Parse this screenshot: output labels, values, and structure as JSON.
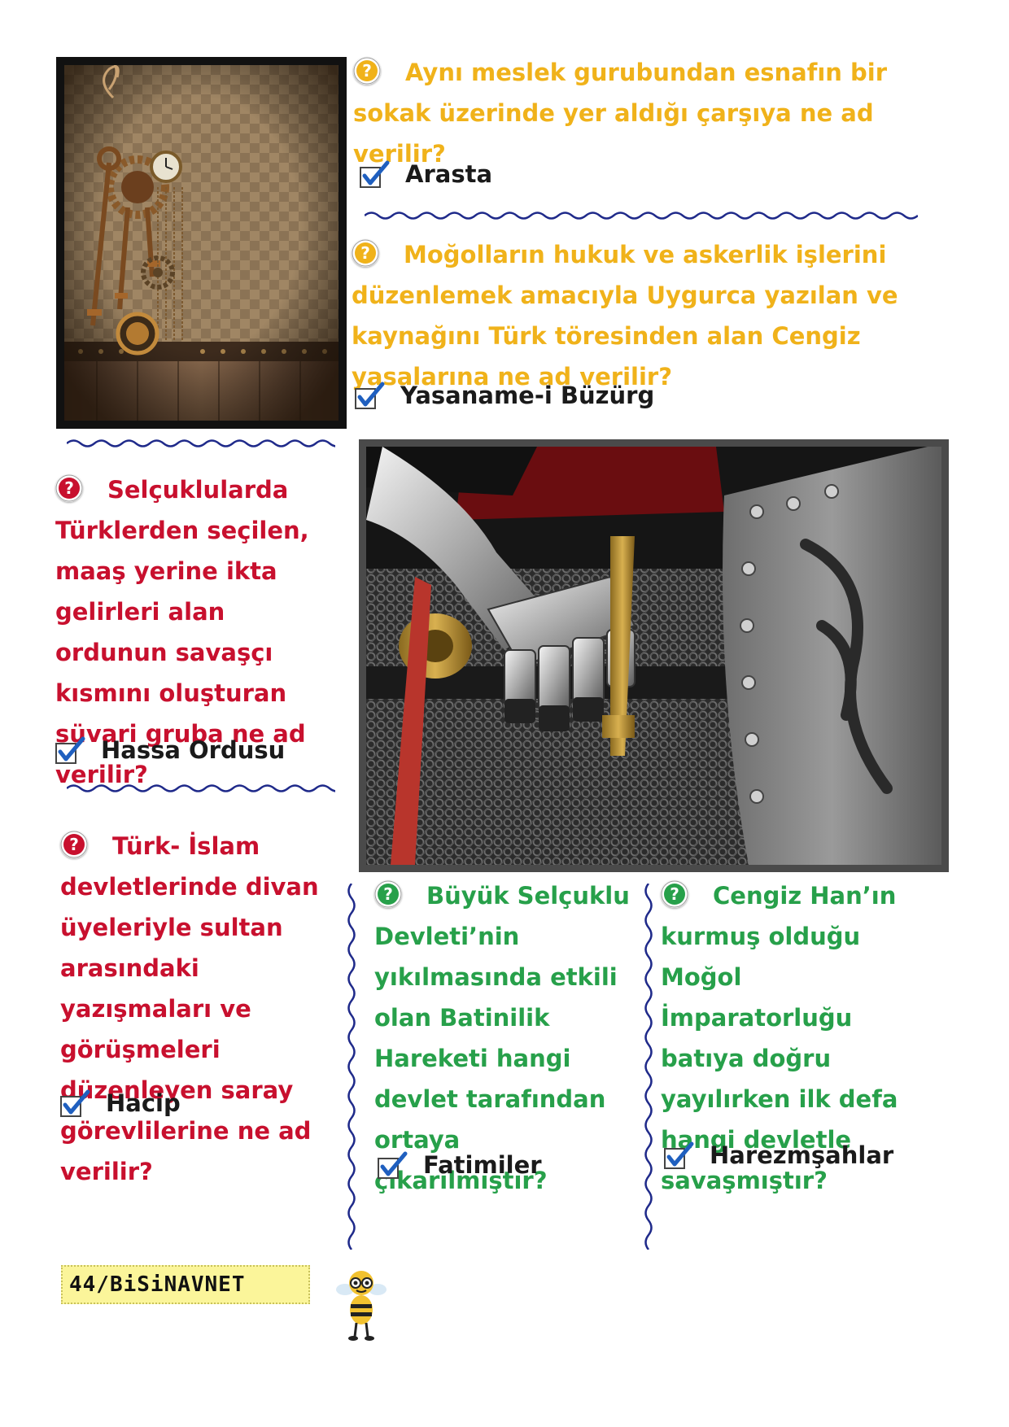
{
  "qa": [
    {
      "question": "Aynı meslek gurubundan esnafın bir sokak üzerinde yer aldığı çarşıya ne ad verilir?",
      "answer": "Arasta"
    },
    {
      "question": "Moğolların hukuk ve askerlik işlerini düzenlemek amacıyla Uygurca yazılan ve kaynağını Türk töresinden alan Cengiz yasalarına ne ad verilir?",
      "answer": "Yasaname-i Büzürg"
    },
    {
      "question": "Selçuklularda Türklerden seçilen, maaş yerine ikta gelirleri alan ordunun savaşçı kısmını oluşturan süvari gruba ne ad verilir?",
      "answer": "Hassa Ordusu"
    },
    {
      "question": "Türk- İslam devletlerinde divan üyeleriyle sultan arasındaki yazışmaları ve görüşmeleri düzenleyen saray görevlilerine ne ad verilir?",
      "answer": "Hacip"
    },
    {
      "question": "Büyük Selçuklu Devleti’nin yıkılmasında etkili olan Batinilik Hareketi hangi devlet tarafından ortaya çıkarılmıştır?",
      "answer": "Fatimiler"
    },
    {
      "question": "Cengiz Han’ın kurmuş olduğu Moğol İmparatorluğu batıya doğru yayılırken ilk defa hangi devletle savaşmıştır?",
      "answer": "Harezmşahlar"
    }
  ],
  "footer": {
    "page_label": "44/BiSiNAVNET"
  },
  "colors": {
    "yellow": "#f0b21a",
    "red": "#c8102e",
    "green": "#27a04a",
    "wave": "#1f2a8a"
  }
}
